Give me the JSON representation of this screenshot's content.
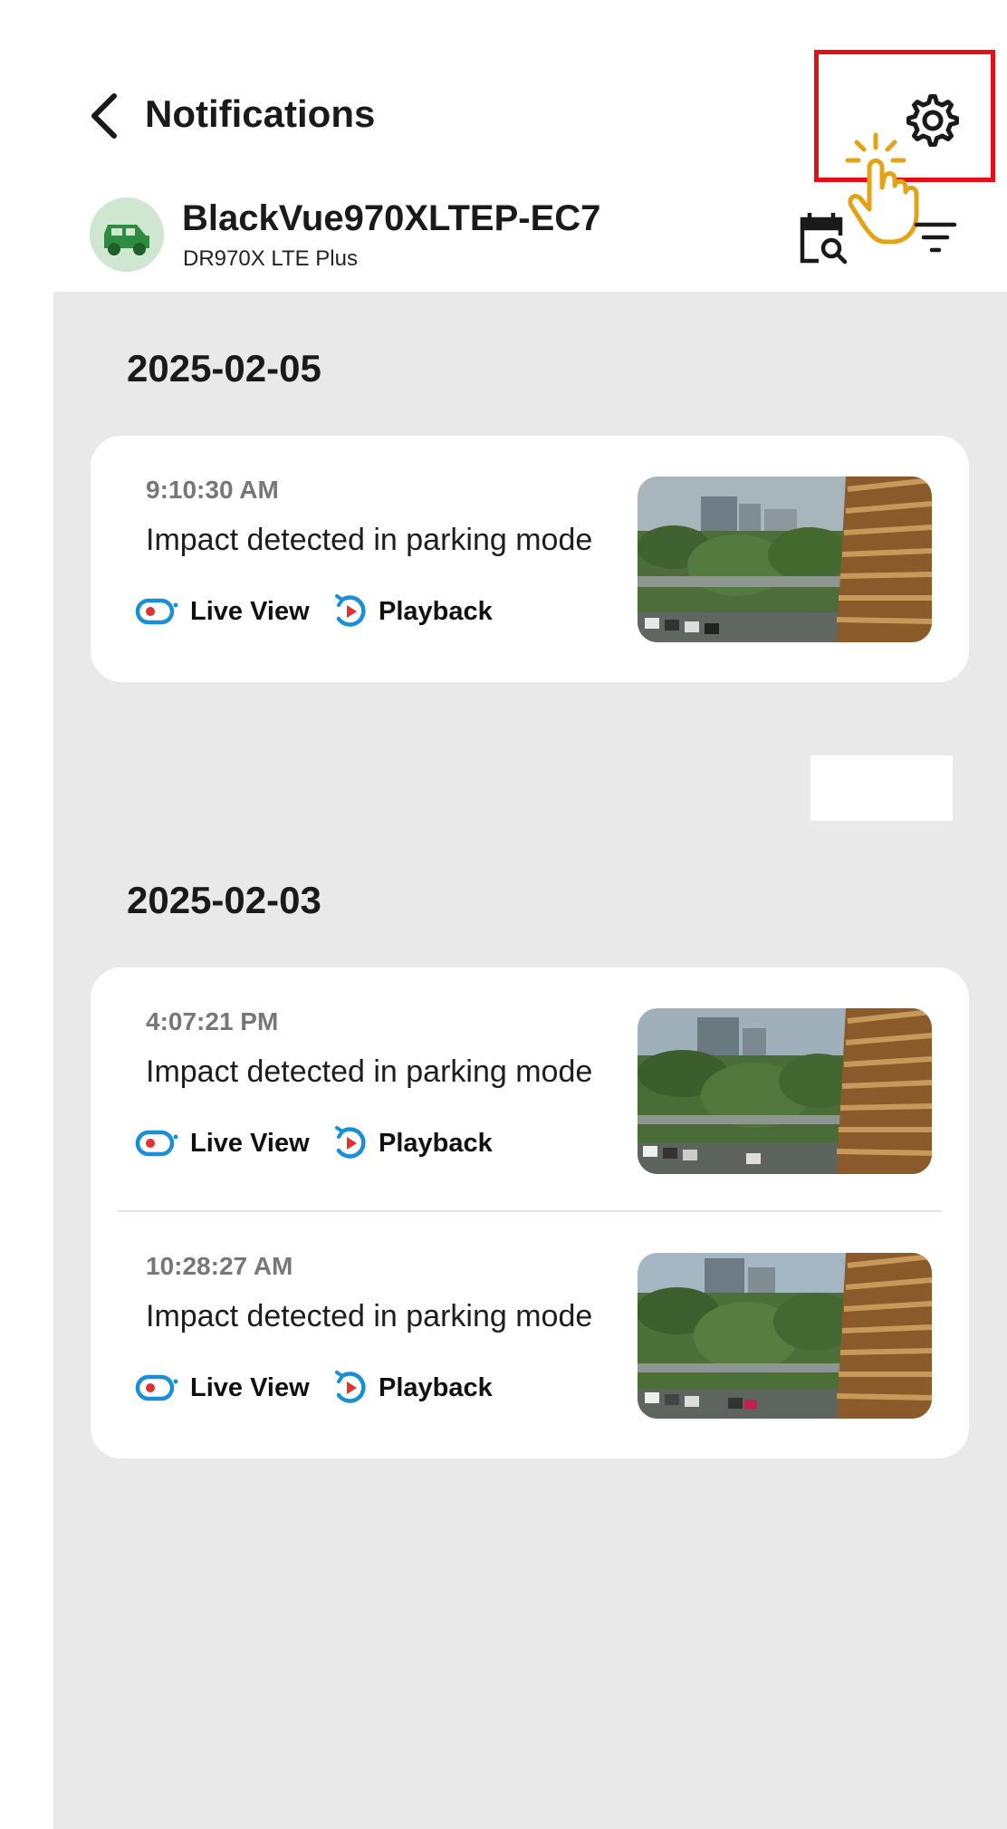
{
  "header": {
    "title": "Notifications",
    "back_icon": "chevron-left-icon",
    "settings_icon": "gear-icon",
    "accent_highlight": "#e3101b",
    "pointer_icon": "tap-hand-icon"
  },
  "device": {
    "name": "BlackVue970XLTEP-EC7",
    "model": "DR970X LTE Plus",
    "avatar_icon": "car-icon",
    "avatar_color": "#2e8b3f",
    "calendar_icon": "calendar-search-icon",
    "filter_icon": "filter-icon"
  },
  "groups": [
    {
      "date": "2025-02-05",
      "items": [
        {
          "time": "9:10:30 AM",
          "message": "Impact detected in parking mode",
          "live_view_label": "Live View",
          "playback_label": "Playback"
        }
      ]
    },
    {
      "date": "2025-02-03",
      "items": [
        {
          "time": "4:07:21 PM",
          "message": "Impact detected in parking mode",
          "live_view_label": "Live View",
          "playback_label": "Playback"
        },
        {
          "time": "10:28:27 AM",
          "message": "Impact detected in parking mode",
          "live_view_label": "Live View",
          "playback_label": "Playback"
        }
      ]
    }
  ],
  "colors": {
    "live_view_icon": "#1a8fd6",
    "live_view_dot": "#e0322f",
    "playback_icon": "#1a8fd6",
    "playback_triangle": "#e0322f",
    "content_bg": "#e9e9e9"
  }
}
